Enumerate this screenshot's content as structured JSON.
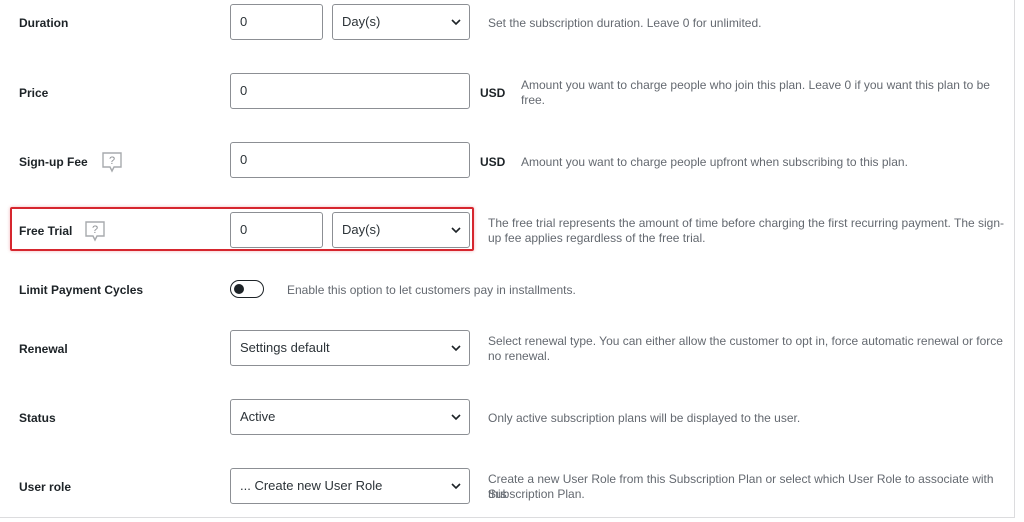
{
  "colors": {
    "highlight": "#d6262e",
    "text": "#1d2327",
    "description": "#646970",
    "border": "#8c8f94"
  },
  "fields": {
    "duration": {
      "label": "Duration",
      "value": "0",
      "unit_select": "Day(s)",
      "description": "Set the subscription duration. Leave 0 for unlimited."
    },
    "price": {
      "label": "Price",
      "value": "0",
      "currency": "USD",
      "description_line1": "Amount you want to charge people who join this plan. Leave 0 if you want this plan to be",
      "description_line2": "free."
    },
    "signup_fee": {
      "label": "Sign-up Fee",
      "help_icon": "question-tooltip-icon",
      "value": "0",
      "currency": "USD",
      "description": "Amount you want to charge people upfront when subscribing to this plan."
    },
    "free_trial": {
      "label": "Free Trial",
      "help_icon": "question-tooltip-icon",
      "value": "0",
      "unit_select": "Day(s)",
      "description_line1": "The free trial represents the amount of time before charging the first recurring payment. The sign-",
      "description_line2": "up fee applies regardless of the free trial."
    },
    "limit_payment_cycles": {
      "label": "Limit Payment Cycles",
      "enabled": false,
      "description": "Enable this option to let customers pay in installments."
    },
    "renewal": {
      "label": "Renewal",
      "selected": "Settings default",
      "description_line1": "Select renewal type. You can either allow the customer to opt in, force automatic renewal or force",
      "description_line2": "no renewal."
    },
    "status": {
      "label": "Status",
      "selected": "Active",
      "description": "Only active subscription plans will be displayed to the user."
    },
    "user_role": {
      "label": "User role",
      "selected": "... Create new User Role",
      "description_line1": "Create a new User Role from this Subscription Plan or select which User Role to associate with this",
      "description_line2": "Subscription Plan."
    }
  }
}
